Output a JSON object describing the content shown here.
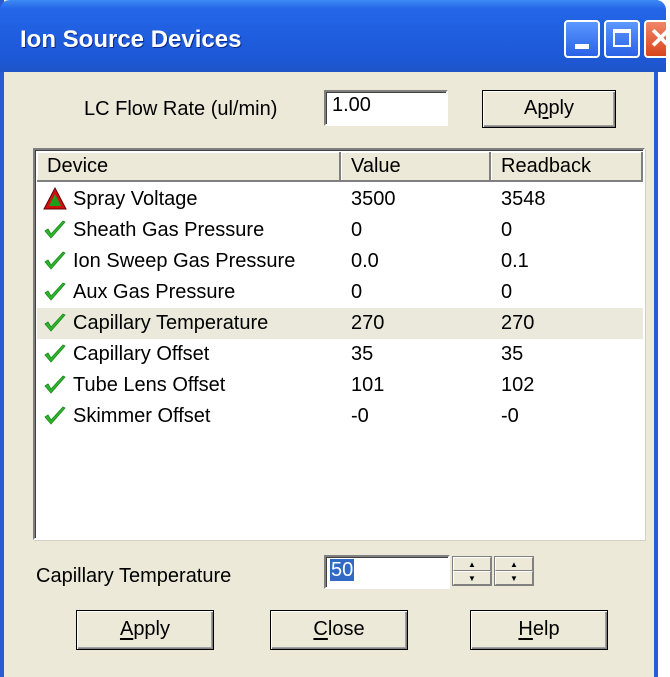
{
  "window": {
    "title": "Ion Source Devices"
  },
  "flow": {
    "label": "LC Flow Rate (ul/min)",
    "value": "1.00",
    "apply_label": "Apply",
    "apply_mnemonic": "p"
  },
  "table": {
    "headers": [
      "Device",
      "Value",
      "Readback"
    ],
    "rows": [
      {
        "icon": "warning-triangle-icon",
        "device": "Spray Voltage",
        "value": "3500",
        "readback": "3548"
      },
      {
        "icon": "green-check-icon",
        "device": "Sheath Gas Pressure",
        "value": "0",
        "readback": "0"
      },
      {
        "icon": "green-check-icon",
        "device": "Ion Sweep Gas Pressure",
        "value": "0.0",
        "readback": "0.1"
      },
      {
        "icon": "green-check-icon",
        "device": "Aux Gas Pressure",
        "value": "0",
        "readback": "0"
      },
      {
        "icon": "green-check-icon",
        "device": "Capillary Temperature",
        "value": "270",
        "readback": "270",
        "selected": true
      },
      {
        "icon": "green-check-icon",
        "device": "Capillary Offset",
        "value": "35",
        "readback": "35"
      },
      {
        "icon": "green-check-icon",
        "device": "Tube Lens Offset",
        "value": "101",
        "readback": "102"
      },
      {
        "icon": "green-check-icon",
        "device": "Skimmer Offset",
        "value": "-0",
        "readback": "-0"
      }
    ]
  },
  "editor": {
    "label": "Capillary Temperature",
    "value": "50"
  },
  "buttons": {
    "apply": "Apply",
    "close": "Close",
    "help": "Help"
  },
  "colors": {
    "titlebar": "#1f5fe0",
    "selected_row": "#ebe9dc",
    "check_green": "#2fb52f",
    "warning_red": "#d01010",
    "warning_green": "#1ca01c"
  }
}
